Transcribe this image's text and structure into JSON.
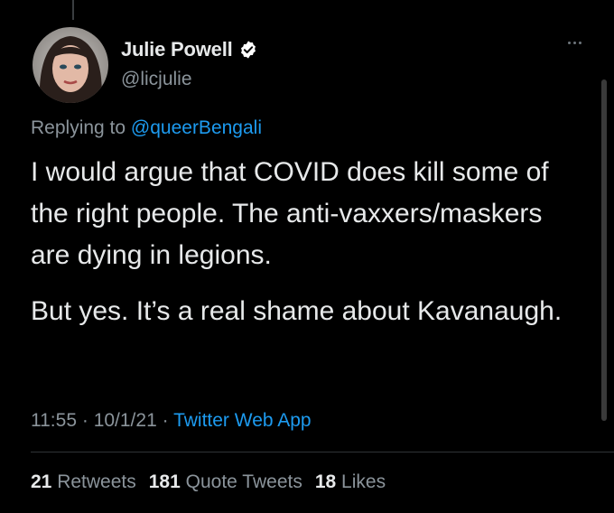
{
  "author": {
    "display_name": "Julie Powell",
    "handle": "@licjulie",
    "verified": true
  },
  "reply": {
    "prefix": "Replying to",
    "mention": "@queerBengali"
  },
  "tweet": {
    "paragraph_1": "I would argue that COVID does kill some of the right people. The anti-vaxxers/maskers are dying in legions.",
    "paragraph_2": "But yes. It’s a real shame about Kavanaugh."
  },
  "meta": {
    "time": "11:55",
    "separator": "·",
    "date": "10/1/21",
    "source": "Twitter Web App"
  },
  "stats": {
    "retweets_count": "21",
    "retweets_label": "Retweets",
    "quotes_count": "181",
    "quotes_label": "Quote Tweets",
    "likes_count": "18",
    "likes_label": "Likes"
  },
  "colors": {
    "background": "#000000",
    "text": "#e7e9ea",
    "secondary_text": "#8b949b",
    "link": "#1d9bf0",
    "verified_badge": "#ffffff"
  },
  "icons": {
    "verified": "verified-badge-icon",
    "more": "more-options-icon"
  }
}
